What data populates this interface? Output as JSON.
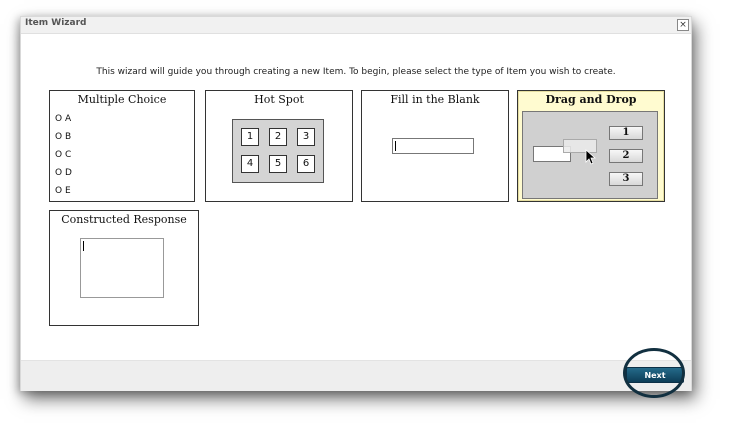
{
  "window": {
    "title": "Item Wizard",
    "close_glyph": "×",
    "close_icon": "close-icon"
  },
  "intro_text": "This wizard will guide you through creating a new Item. To begin, please select the type of Item you wish to create.",
  "item_types": {
    "multiple_choice": {
      "title": "Multiple Choice",
      "options": [
        "O A",
        "O B",
        "O C",
        "O D",
        "O E"
      ]
    },
    "hot_spot": {
      "title": "Hot Spot",
      "cells": [
        "1",
        "2",
        "3",
        "4",
        "5",
        "6"
      ]
    },
    "fill_in_blank": {
      "title": "Fill in the Blank"
    },
    "drag_and_drop": {
      "title": "Drag and Drop",
      "selected": true,
      "choices": [
        "1",
        "2",
        "3"
      ],
      "cursor_icon": "mouse-pointer-icon"
    },
    "constructed_response": {
      "title": "Constructed Response"
    }
  },
  "footer": {
    "next_label": "Next"
  },
  "colors": {
    "selected_card_bg": "#fffbd0",
    "next_button": "#1a5677",
    "highlight_ring": "#123040"
  }
}
